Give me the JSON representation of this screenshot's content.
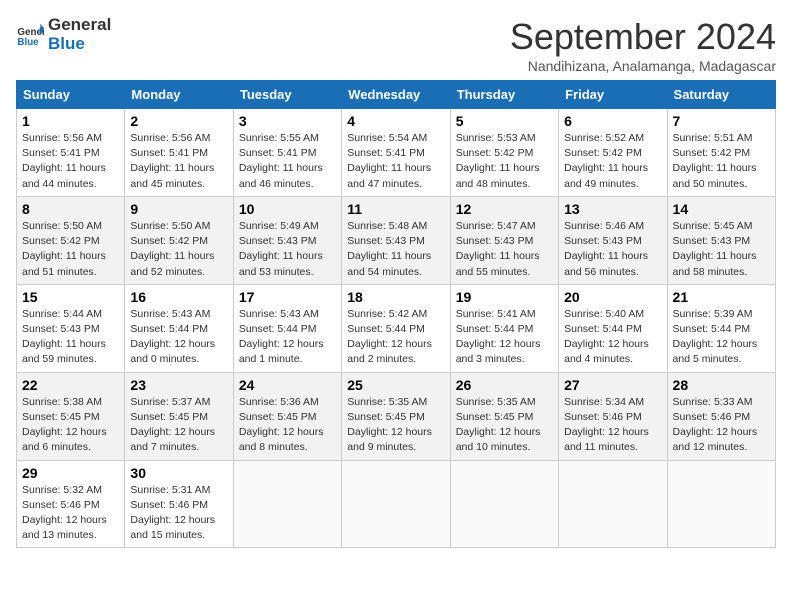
{
  "logo": {
    "line1": "General",
    "line2": "Blue"
  },
  "title": "September 2024",
  "subtitle": "Nandihizana, Analamanga, Madagascar",
  "headers": [
    "Sunday",
    "Monday",
    "Tuesday",
    "Wednesday",
    "Thursday",
    "Friday",
    "Saturday"
  ],
  "weeks": [
    [
      {
        "day": "1",
        "info": "Sunrise: 5:56 AM\nSunset: 5:41 PM\nDaylight: 11 hours\nand 44 minutes."
      },
      {
        "day": "2",
        "info": "Sunrise: 5:56 AM\nSunset: 5:41 PM\nDaylight: 11 hours\nand 45 minutes."
      },
      {
        "day": "3",
        "info": "Sunrise: 5:55 AM\nSunset: 5:41 PM\nDaylight: 11 hours\nand 46 minutes."
      },
      {
        "day": "4",
        "info": "Sunrise: 5:54 AM\nSunset: 5:41 PM\nDaylight: 11 hours\nand 47 minutes."
      },
      {
        "day": "5",
        "info": "Sunrise: 5:53 AM\nSunset: 5:42 PM\nDaylight: 11 hours\nand 48 minutes."
      },
      {
        "day": "6",
        "info": "Sunrise: 5:52 AM\nSunset: 5:42 PM\nDaylight: 11 hours\nand 49 minutes."
      },
      {
        "day": "7",
        "info": "Sunrise: 5:51 AM\nSunset: 5:42 PM\nDaylight: 11 hours\nand 50 minutes."
      }
    ],
    [
      {
        "day": "8",
        "info": "Sunrise: 5:50 AM\nSunset: 5:42 PM\nDaylight: 11 hours\nand 51 minutes."
      },
      {
        "day": "9",
        "info": "Sunrise: 5:50 AM\nSunset: 5:42 PM\nDaylight: 11 hours\nand 52 minutes."
      },
      {
        "day": "10",
        "info": "Sunrise: 5:49 AM\nSunset: 5:43 PM\nDaylight: 11 hours\nand 53 minutes."
      },
      {
        "day": "11",
        "info": "Sunrise: 5:48 AM\nSunset: 5:43 PM\nDaylight: 11 hours\nand 54 minutes."
      },
      {
        "day": "12",
        "info": "Sunrise: 5:47 AM\nSunset: 5:43 PM\nDaylight: 11 hours\nand 55 minutes."
      },
      {
        "day": "13",
        "info": "Sunrise: 5:46 AM\nSunset: 5:43 PM\nDaylight: 11 hours\nand 56 minutes."
      },
      {
        "day": "14",
        "info": "Sunrise: 5:45 AM\nSunset: 5:43 PM\nDaylight: 11 hours\nand 58 minutes."
      }
    ],
    [
      {
        "day": "15",
        "info": "Sunrise: 5:44 AM\nSunset: 5:43 PM\nDaylight: 11 hours\nand 59 minutes."
      },
      {
        "day": "16",
        "info": "Sunrise: 5:43 AM\nSunset: 5:44 PM\nDaylight: 12 hours\nand 0 minutes."
      },
      {
        "day": "17",
        "info": "Sunrise: 5:43 AM\nSunset: 5:44 PM\nDaylight: 12 hours\nand 1 minute."
      },
      {
        "day": "18",
        "info": "Sunrise: 5:42 AM\nSunset: 5:44 PM\nDaylight: 12 hours\nand 2 minutes."
      },
      {
        "day": "19",
        "info": "Sunrise: 5:41 AM\nSunset: 5:44 PM\nDaylight: 12 hours\nand 3 minutes."
      },
      {
        "day": "20",
        "info": "Sunrise: 5:40 AM\nSunset: 5:44 PM\nDaylight: 12 hours\nand 4 minutes."
      },
      {
        "day": "21",
        "info": "Sunrise: 5:39 AM\nSunset: 5:44 PM\nDaylight: 12 hours\nand 5 minutes."
      }
    ],
    [
      {
        "day": "22",
        "info": "Sunrise: 5:38 AM\nSunset: 5:45 PM\nDaylight: 12 hours\nand 6 minutes."
      },
      {
        "day": "23",
        "info": "Sunrise: 5:37 AM\nSunset: 5:45 PM\nDaylight: 12 hours\nand 7 minutes."
      },
      {
        "day": "24",
        "info": "Sunrise: 5:36 AM\nSunset: 5:45 PM\nDaylight: 12 hours\nand 8 minutes."
      },
      {
        "day": "25",
        "info": "Sunrise: 5:35 AM\nSunset: 5:45 PM\nDaylight: 12 hours\nand 9 minutes."
      },
      {
        "day": "26",
        "info": "Sunrise: 5:35 AM\nSunset: 5:45 PM\nDaylight: 12 hours\nand 10 minutes."
      },
      {
        "day": "27",
        "info": "Sunrise: 5:34 AM\nSunset: 5:46 PM\nDaylight: 12 hours\nand 11 minutes."
      },
      {
        "day": "28",
        "info": "Sunrise: 5:33 AM\nSunset: 5:46 PM\nDaylight: 12 hours\nand 12 minutes."
      }
    ],
    [
      {
        "day": "29",
        "info": "Sunrise: 5:32 AM\nSunset: 5:46 PM\nDaylight: 12 hours\nand 13 minutes."
      },
      {
        "day": "30",
        "info": "Sunrise: 5:31 AM\nSunset: 5:46 PM\nDaylight: 12 hours\nand 15 minutes."
      },
      null,
      null,
      null,
      null,
      null
    ]
  ]
}
